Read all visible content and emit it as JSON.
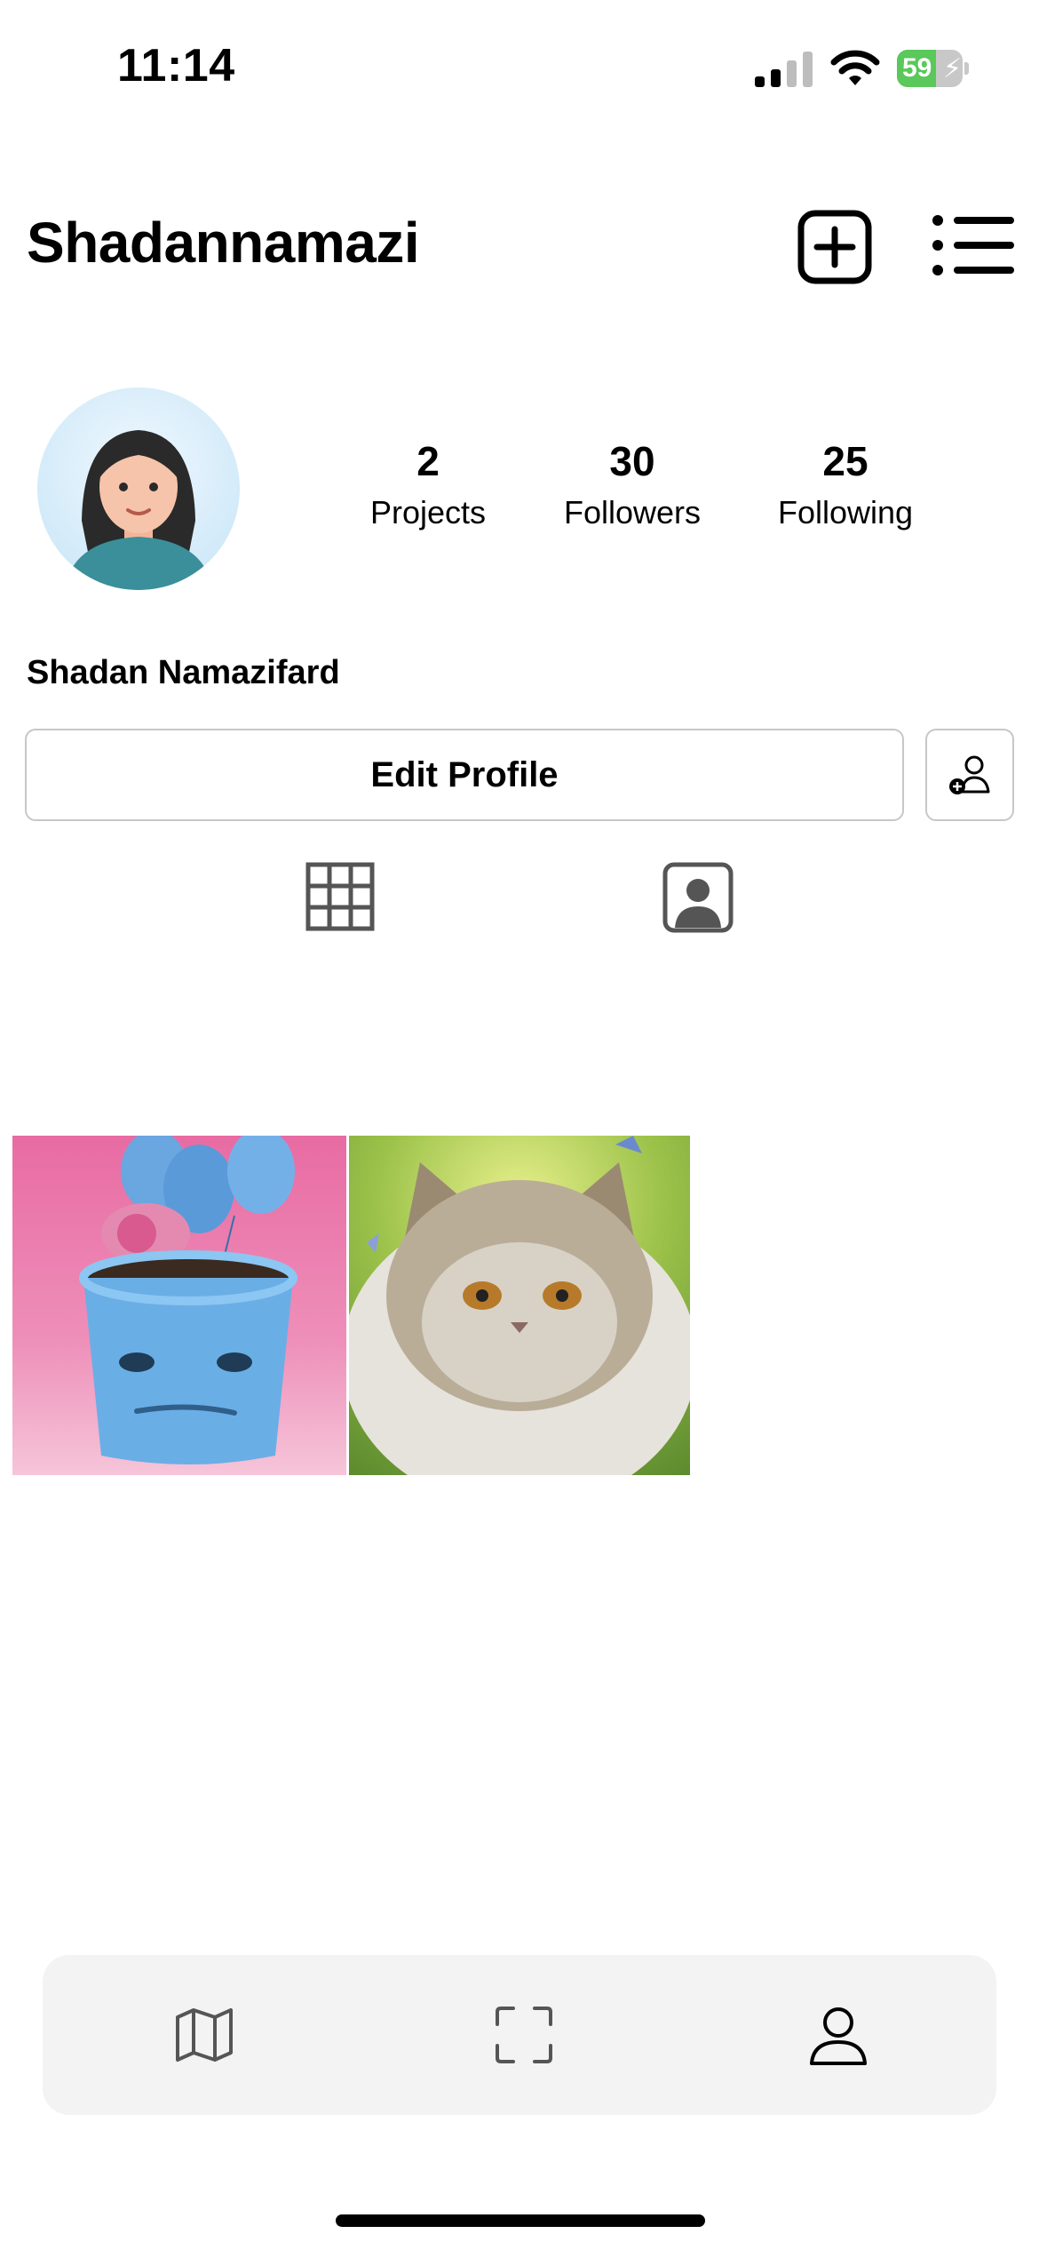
{
  "status_bar": {
    "time": "11:14",
    "battery_percent": "59",
    "battery_level": 0.59
  },
  "header": {
    "username": "Shadannamazi"
  },
  "profile": {
    "stats": [
      {
        "value": "2",
        "label": "Projects"
      },
      {
        "value": "30",
        "label": "Followers"
      },
      {
        "value": "25",
        "label": "Following"
      }
    ],
    "display_name": "Shadan Namazifard",
    "edit_button_label": "Edit Profile"
  },
  "tabs": {
    "active": "grid"
  },
  "posts": [
    {
      "subject": "blue flower pot with balloons"
    },
    {
      "subject": "persian cat"
    }
  ],
  "bottom_nav": {
    "items": [
      "map",
      "scan",
      "profile"
    ],
    "active": "profile"
  },
  "colors": {
    "battery_green": "#5ac85a",
    "icon_gray": "#555555",
    "tab_bar_bg": "#f3f3f3"
  }
}
